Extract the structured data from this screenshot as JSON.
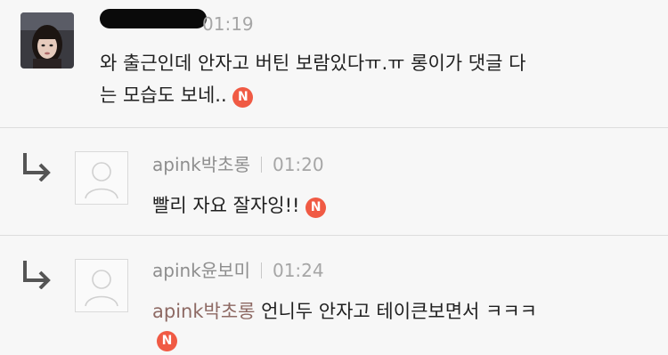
{
  "comments": [
    {
      "author": "",
      "time": "01:19",
      "text_line1": "와 출근인데 안자고 버틴 보람있다ㅠ.ㅠ 롱이가 댓글 다",
      "text_line2": "는 모습도 보네..",
      "badge": "N",
      "avatar_icon": "profile-photo"
    },
    {
      "author": "apink박초롱",
      "time": "01:20",
      "text": "빨리 자요 잘자잉!!",
      "badge": "N",
      "avatar_icon": "default-user-icon",
      "reply_icon": "reply-arrow-icon"
    },
    {
      "author": "apink윤보미",
      "time": "01:24",
      "mention": "apink박초롱",
      "text": "언니두 안자고 테이큰보면서 ㅋㅋㅋ",
      "badge": "N",
      "avatar_icon": "default-user-icon",
      "reply_icon": "reply-arrow-icon"
    }
  ],
  "colors": {
    "background": "#f7f7f7",
    "badge": "#f05a44",
    "mention": "#8e6a64",
    "divider": "#dcdcdc"
  }
}
